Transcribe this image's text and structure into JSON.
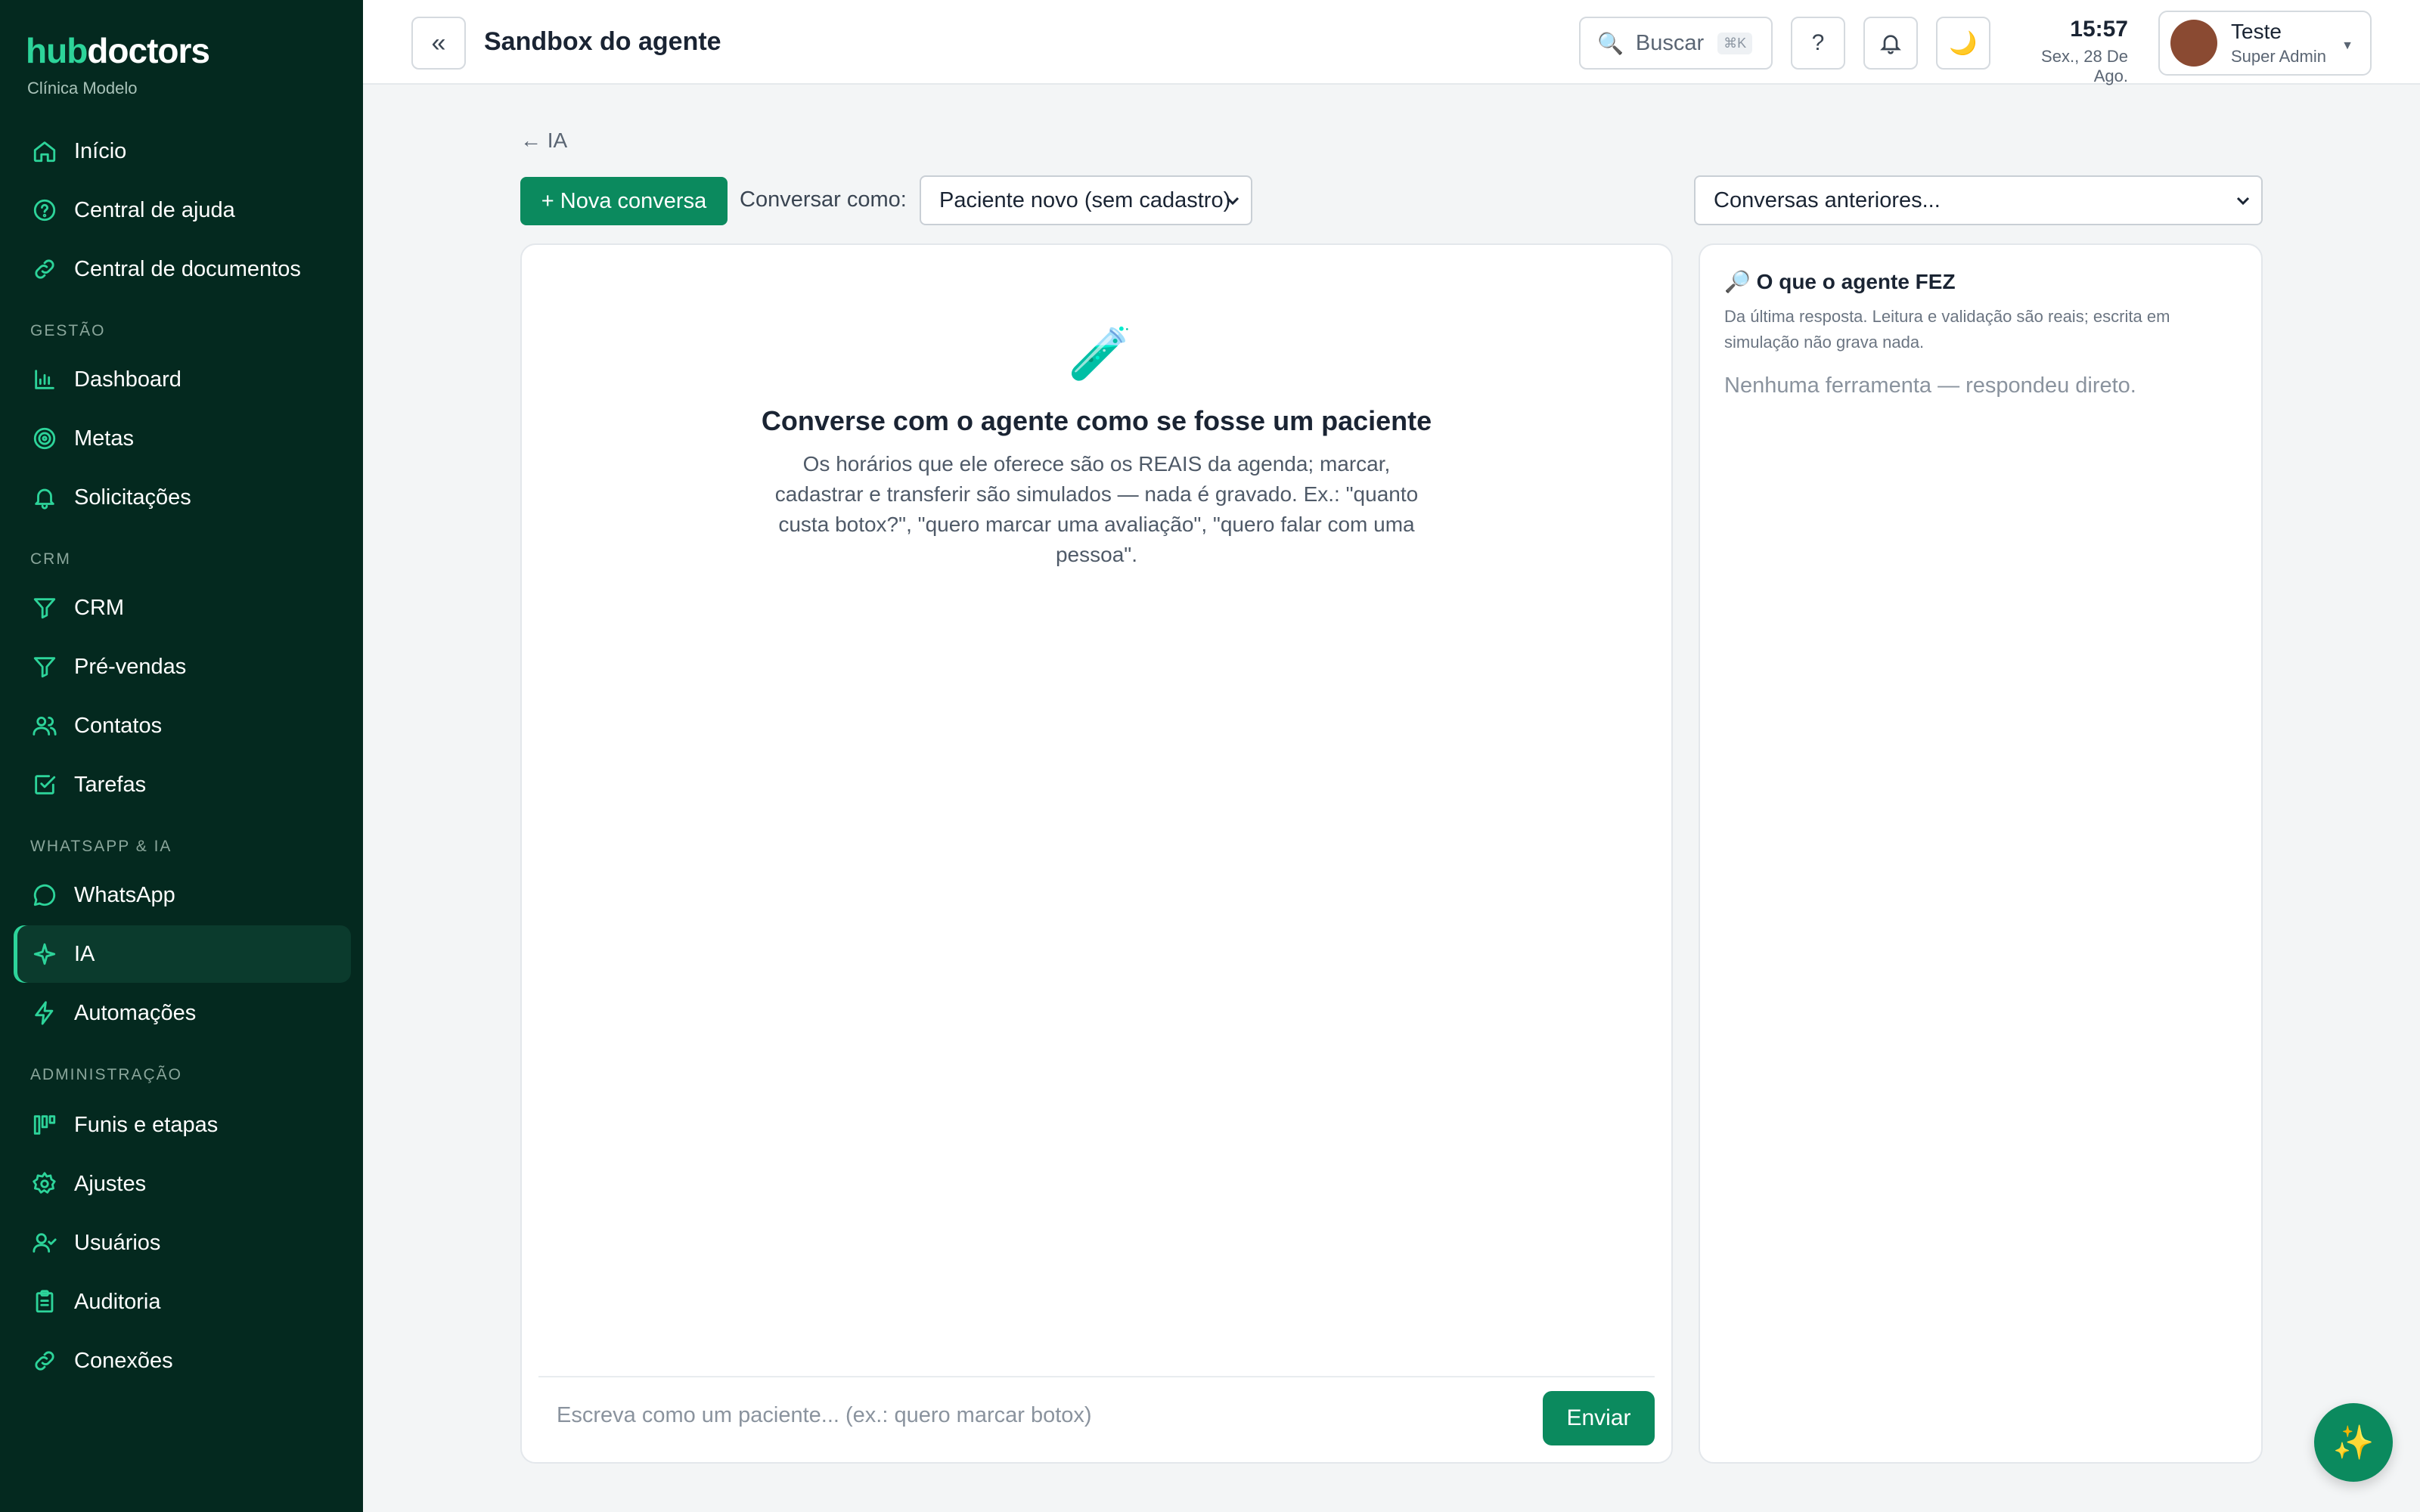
{
  "sidebar": {
    "brand_a": "hub",
    "brand_b": "doctors",
    "clinic": "Clínica Modelo",
    "items_top": [
      {
        "label": "Início",
        "icon": "home-icon"
      },
      {
        "label": "Central de ajuda",
        "icon": "help-circle-icon"
      },
      {
        "label": "Central de documentos",
        "icon": "link-icon"
      }
    ],
    "section_gestao": "GESTÃO",
    "items_gestao": [
      {
        "label": "Dashboard",
        "icon": "bar-chart-icon"
      },
      {
        "label": "Metas",
        "icon": "target-icon"
      },
      {
        "label": "Solicitações",
        "icon": "bell-icon"
      }
    ],
    "section_crm": "CRM",
    "items_crm": [
      {
        "label": "CRM",
        "icon": "funnel-icon"
      },
      {
        "label": "Pré-vendas",
        "icon": "funnel-icon"
      },
      {
        "label": "Contatos",
        "icon": "users-icon"
      },
      {
        "label": "Tarefas",
        "icon": "checkbox-icon"
      }
    ],
    "section_whatsapp": "WHATSAPP & IA",
    "items_whatsapp": [
      {
        "label": "WhatsApp",
        "icon": "chat-bubble-icon"
      },
      {
        "label": "IA",
        "icon": "sparkle-icon",
        "active": true
      },
      {
        "label": "Automações",
        "icon": "lightning-icon"
      }
    ],
    "section_admin": "ADMINISTRAÇÃO",
    "items_admin": [
      {
        "label": "Funis e etapas",
        "icon": "kanban-icon"
      },
      {
        "label": "Ajustes",
        "icon": "gear-icon"
      },
      {
        "label": "Usuários",
        "icon": "user-check-icon"
      },
      {
        "label": "Auditoria",
        "icon": "clipboard-icon"
      },
      {
        "label": "Conexões",
        "icon": "link-icon"
      }
    ]
  },
  "header": {
    "collapse_label": "«",
    "title": "Sandbox do agente",
    "search_label": "Buscar",
    "search_shortcut": "⌘K",
    "help_label": "?",
    "time": "15:57",
    "date": "Sex., 28 De Ago.",
    "user_name": "Teste",
    "user_role": "Super Admin"
  },
  "main": {
    "back_link": "← IA",
    "new_conversation": "+ Nova conversa",
    "converse_as_label": "Conversar como:",
    "converse_as_value": "Paciente novo (sem cadastro)",
    "previous_conversations": "Conversas anteriores...",
    "empty_title": "Converse com o agente como se fosse um paciente",
    "empty_description": "Os horários que ele oferece são os REAIS da agenda; marcar, cadastrar e transferir são simulados — nada é gravado. Ex.: \"quanto custa botox?\", \"quero marcar uma avaliação\", \"quero falar com uma pessoa\".",
    "input_placeholder": "Escreva como um paciente... (ex.: quero marcar botox)",
    "send_label": "Enviar"
  },
  "side_panel": {
    "title": "O que o agente FEZ",
    "subtitle": "Da última resposta. Leitura e validação são reais; escrita em simulação não grava nada.",
    "empty": "Nenhuma ferramenta — respondeu direto."
  },
  "colors": {
    "sidebar_bg": "#04291f",
    "accent": "#2dd49a",
    "primary_button": "#0b8a5e"
  }
}
